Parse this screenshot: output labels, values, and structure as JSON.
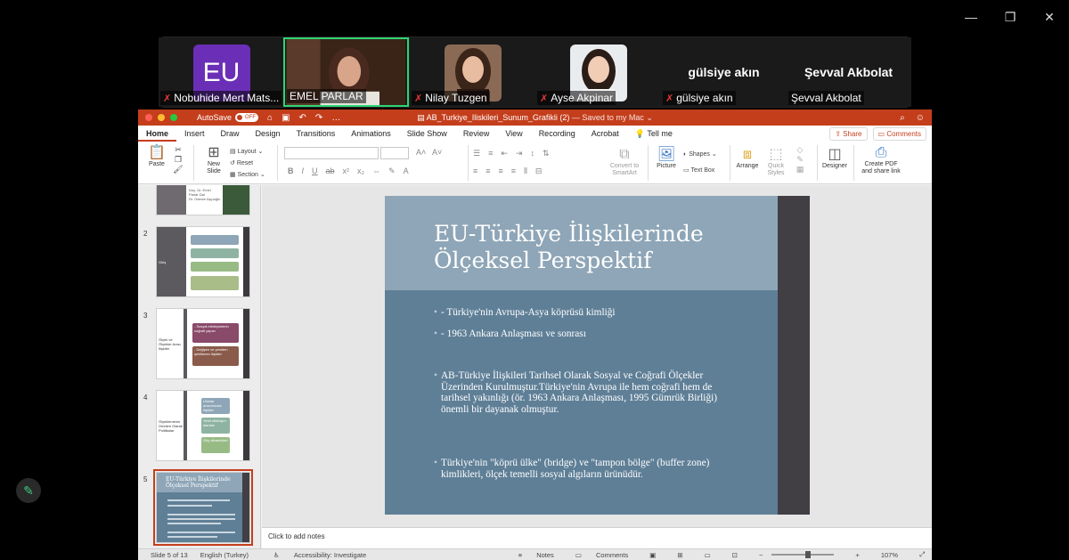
{
  "window_controls": {
    "minimize": "—",
    "restore": "❐",
    "close": "✕"
  },
  "participants": [
    {
      "name": "Nobuhide Mert Mats...",
      "avatar_text": "EU",
      "muted": true,
      "active": false,
      "type": "avatar"
    },
    {
      "name": "EMEL PARLAR",
      "muted": false,
      "active": true,
      "type": "video"
    },
    {
      "name": "Nilay Tuzgen",
      "muted": true,
      "active": false,
      "type": "video"
    },
    {
      "name": "Ayse Akpinar",
      "muted": true,
      "active": false,
      "type": "video"
    },
    {
      "name": "gülsiye akın",
      "display_name": "gülsiye akın",
      "muted": true,
      "active": false,
      "type": "name"
    },
    {
      "name": "Şevval Akbolat",
      "display_name": "Şevval Akbolat",
      "muted": false,
      "active": false,
      "type": "name"
    }
  ],
  "ppt": {
    "autosave_label": "AutoSave",
    "autosave_state": "OFF",
    "doc_title": "AB_Turkiye_Iliskileri_Sunum_Grafikli (2)",
    "saved_status": "— Saved to my Mac ⌄",
    "tabs": [
      "Home",
      "Insert",
      "Draw",
      "Design",
      "Transitions",
      "Animations",
      "Slide Show",
      "Review",
      "View",
      "Recording",
      "Acrobat",
      "Tell me"
    ],
    "share_label": "Share",
    "comments_label": "Comments",
    "ribbon": {
      "paste": "Paste",
      "new_slide": "New\nSlide",
      "layout": "Layout",
      "reset": "Reset",
      "section": "Section",
      "convert_smartart": "Convert to\nSmartArt",
      "picture": "Picture",
      "shapes": "Shapes",
      "text_box": "Text Box",
      "arrange": "Arrange",
      "quick_styles": "Quick\nStyles",
      "designer": "Designer",
      "create_pdf": "Create PDF\nand share link"
    },
    "thumbnails": [
      {
        "num": "",
        "left_text": "Doç. Dr. Emel Parlar Dal\nDr. Gamze Aşçıoğlu",
        "selected": false
      },
      {
        "num": "2",
        "left_text": "Giriş",
        "selected": false
      },
      {
        "num": "3",
        "left_text": "Ölçek ve Ölçekler Arası İlişkiler",
        "boxes": [
          "- Sosyal etkileşimlerin coğrafi yapısı",
          "- Değişen ve yeniden şekillenen ilişkiler"
        ],
        "selected": false
      },
      {
        "num": "4",
        "left_text": "Ölçeklemenin Ürünleri Olarak Politikalar",
        "boxes": [
          "Uluslar arası/ulusal ilişkiler",
          "Yerel etkileşim alanları",
          "Güç dinamikleri"
        ],
        "selected": false
      },
      {
        "num": "5",
        "left_text": "EU-Türkiye İlişkilerinde Ölçeksel Perspektif",
        "selected": true
      }
    ],
    "slide": {
      "title_line1": "EU-Türkiye İlişkilerinde",
      "title_line2": "Ölçeksel Perspektif",
      "bullets": [
        "- Türkiye'nin Avrupa-Asya köprüsü kimliği",
        "- 1963 Ankara Anlaşması ve sonrası",
        "AB-Türkiye İlişkileri Tarihsel Olarak Sosyal ve Coğrafi Ölçekler Üzerinden Kurulmuştur.Türkiye'nin Avrupa ile hem coğrafi hem de tarihsel yakınlığı (ör. 1963 Ankara Anlaşması, 1995 Gümrük Birliği) önemli bir dayanak olmuştur.",
        "Türkiye'nin \"köprü ülke\" (bridge) ve \"tampon bölge\" (buffer zone) kimlikleri, ölçek temelli sosyal algıların ürünüdür."
      ]
    },
    "notes_placeholder": "Click to add notes",
    "status": {
      "slide_count": "Slide 5 of 13",
      "language": "English (Turkey)",
      "accessibility": "Accessibility: Investigate",
      "notes": "Notes",
      "comments": "Comments",
      "zoom": "107%"
    }
  },
  "colors": {
    "ppt_accent": "#c43e1c",
    "slide_bg": "#5f7f97",
    "slide_header": "#8ea6b7",
    "slide_bar": "#413e44",
    "active_speaker": "#2ed573",
    "eu_avatar": "#6b2fb7"
  }
}
